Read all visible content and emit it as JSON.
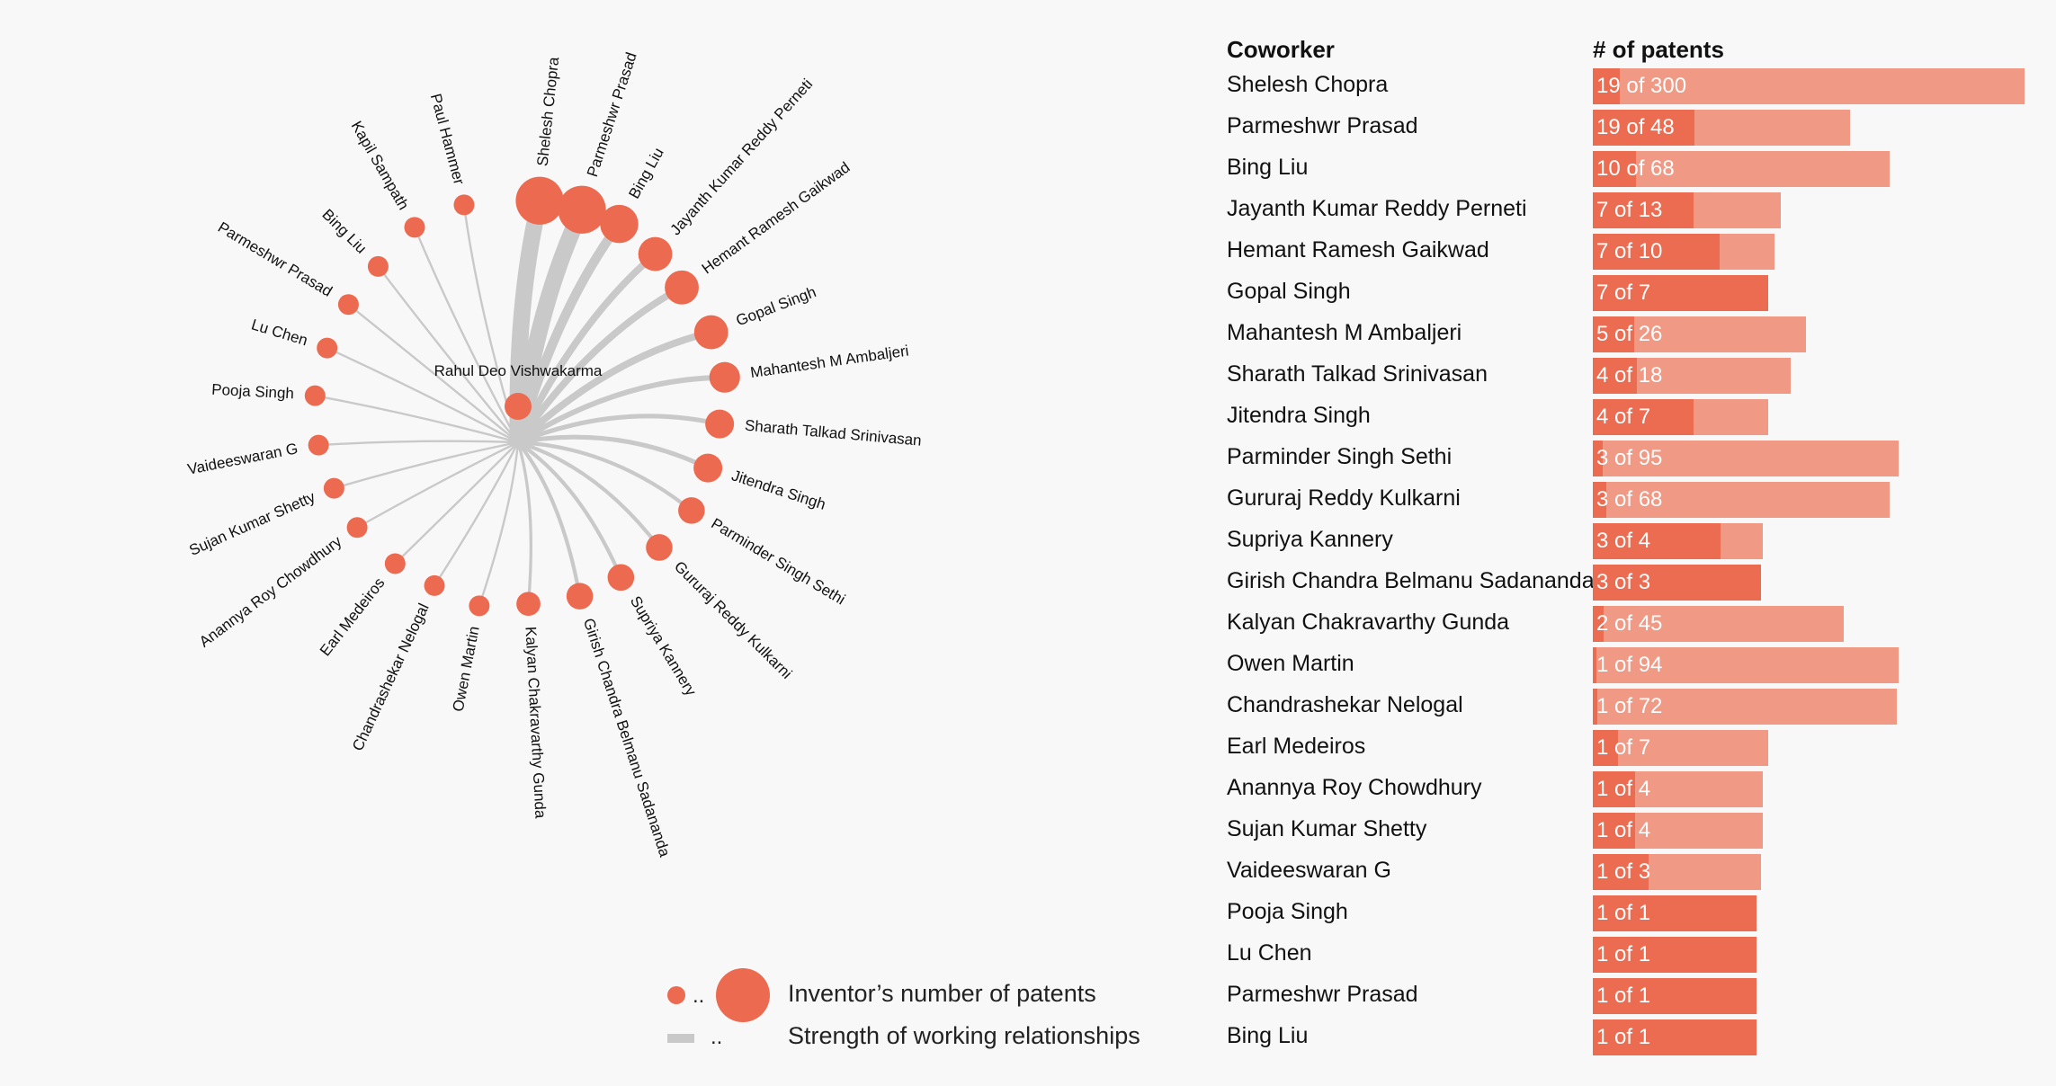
{
  "chart_data": [
    {
      "type": "network",
      "center": "Rahul Deo Vishwakarma",
      "nodes": [
        {
          "name": "Shelesh Chopra",
          "shared": 19
        },
        {
          "name": "Parmeshwr Prasad",
          "shared": 19
        },
        {
          "name": "Bing Liu",
          "shared": 10
        },
        {
          "name": "Jayanth Kumar Reddy Perneti",
          "shared": 7
        },
        {
          "name": "Hemant Ramesh Gaikwad",
          "shared": 7
        },
        {
          "name": "Gopal Singh",
          "shared": 7
        },
        {
          "name": "Mahantesh M Ambaljeri",
          "shared": 5
        },
        {
          "name": "Sharath Talkad Srinivasan",
          "shared": 4
        },
        {
          "name": "Jitendra Singh",
          "shared": 4
        },
        {
          "name": "Parminder Singh Sethi",
          "shared": 3
        },
        {
          "name": "Gururaj Reddy Kulkarni",
          "shared": 3
        },
        {
          "name": "Supriya Kannery",
          "shared": 3
        },
        {
          "name": "Girish Chandra Belmanu Sadananda",
          "shared": 3
        },
        {
          "name": "Kalyan Chakravarthy Gunda",
          "shared": 2
        },
        {
          "name": "Owen Martin",
          "shared": 1
        },
        {
          "name": "Chandrashekar Nelogal",
          "shared": 1
        },
        {
          "name": "Earl Medeiros",
          "shared": 1
        },
        {
          "name": "Anannya Roy Chowdhury",
          "shared": 1
        },
        {
          "name": "Sujan Kumar Shetty",
          "shared": 1
        },
        {
          "name": "Vaideeswaran G",
          "shared": 1
        },
        {
          "name": "Pooja Singh",
          "shared": 1
        },
        {
          "name": "Lu Chen",
          "shared": 1
        },
        {
          "name": "Parmeshwr Prasad",
          "shared": 1
        },
        {
          "name": "Bing Liu",
          "shared": 1
        },
        {
          "name": "Kapil Sampath",
          "shared": 1
        },
        {
          "name": "Paul Hammer",
          "shared": 1
        }
      ]
    },
    {
      "type": "bar",
      "col_headers": [
        "Coworker",
        "# of patents"
      ],
      "rows": [
        {
          "name": "Shelesh Chopra",
          "shared": 19,
          "total": 300,
          "label": "19 of 300"
        },
        {
          "name": "Parmeshwr Prasad",
          "shared": 19,
          "total": 48,
          "label": "19 of 48"
        },
        {
          "name": "Bing Liu",
          "shared": 10,
          "total": 68,
          "label": "10 of 68"
        },
        {
          "name": "Jayanth Kumar Reddy Perneti",
          "shared": 7,
          "total": 13,
          "label": "7 of 13"
        },
        {
          "name": "Hemant Ramesh Gaikwad",
          "shared": 7,
          "total": 10,
          "label": "7 of 10"
        },
        {
          "name": "Gopal Singh",
          "shared": 7,
          "total": 7,
          "label": "7 of 7"
        },
        {
          "name": "Mahantesh M Ambaljeri",
          "shared": 5,
          "total": 26,
          "label": "5 of 26"
        },
        {
          "name": "Sharath Talkad Srinivasan",
          "shared": 4,
          "total": 18,
          "label": "4 of 18"
        },
        {
          "name": "Jitendra Singh",
          "shared": 4,
          "total": 7,
          "label": "4 of 7"
        },
        {
          "name": "Parminder Singh Sethi",
          "shared": 3,
          "total": 95,
          "label": "3 of 95"
        },
        {
          "name": "Gururaj Reddy Kulkarni",
          "shared": 3,
          "total": 68,
          "label": "3 of 68"
        },
        {
          "name": "Supriya Kannery",
          "shared": 3,
          "total": 4,
          "label": "3 of 4"
        },
        {
          "name": "Girish Chandra Belmanu Sadananda",
          "shared": 3,
          "total": 3,
          "label": "3 of 3"
        },
        {
          "name": "Kalyan Chakravarthy Gunda",
          "shared": 2,
          "total": 45,
          "label": "2 of 45"
        },
        {
          "name": "Owen Martin",
          "shared": 1,
          "total": 94,
          "label": "1 of 94"
        },
        {
          "name": "Chandrashekar Nelogal",
          "shared": 1,
          "total": 72,
          "label": "1 of 72"
        },
        {
          "name": "Earl Medeiros",
          "shared": 1,
          "total": 7,
          "label": "1 of 7"
        },
        {
          "name": "Anannya Roy Chowdhury",
          "shared": 1,
          "total": 4,
          "label": "1 of 4"
        },
        {
          "name": "Sujan Kumar Shetty",
          "shared": 1,
          "total": 4,
          "label": "1 of 4"
        },
        {
          "name": "Vaideeswaran G",
          "shared": 1,
          "total": 3,
          "label": "1 of 3"
        },
        {
          "name": "Pooja Singh",
          "shared": 1,
          "total": 1,
          "label": "1 of 1"
        },
        {
          "name": "Lu Chen",
          "shared": 1,
          "total": 1,
          "label": "1 of 1"
        },
        {
          "name": "Parmeshwr Prasad",
          "shared": 1,
          "total": 1,
          "label": "1 of 1"
        },
        {
          "name": "Bing Liu",
          "shared": 1,
          "total": 1,
          "label": "1 of 1"
        }
      ]
    }
  ],
  "legend": {
    "dots": "..",
    "size_label": "Inventor’s number of patents",
    "strength_label": "Strength of working relationships"
  },
  "colors": {
    "node": "#eb6a50",
    "link": "#c9c9c9",
    "bar_total": "#f09a85",
    "bar_shared": "#ec6c52"
  }
}
